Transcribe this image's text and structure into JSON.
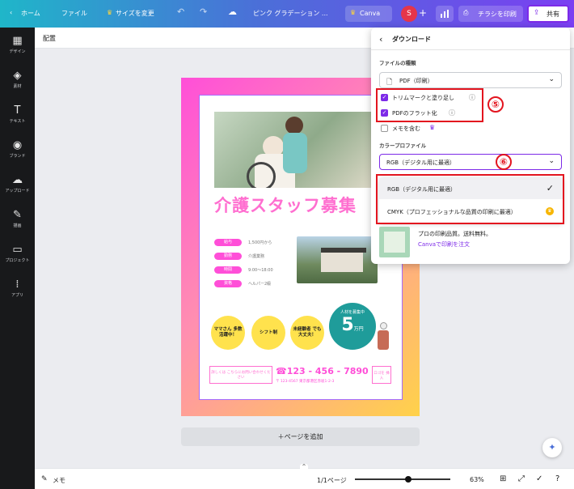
{
  "topbar": {
    "home": "ホーム",
    "file": "ファイル",
    "resize": "サイズを変更",
    "doc_title": "ピンク グラデーション ...",
    "canva_label": "Canva",
    "avatar": "S",
    "print": "チラシを印刷",
    "share": "共有"
  },
  "sidebar": [
    {
      "icon": "▦",
      "label": "デザイン"
    },
    {
      "icon": "◈",
      "label": "素材"
    },
    {
      "icon": "T",
      "label": "テキスト"
    },
    {
      "icon": "◉",
      "label": "ブランド"
    },
    {
      "icon": "☁",
      "label": "アップロード"
    },
    {
      "icon": "✎",
      "label": "描画"
    },
    {
      "icon": "▭",
      "label": "プロジェクト"
    },
    {
      "icon": "⁞",
      "label": "アプリ"
    }
  ],
  "secbar": {
    "label": "配置"
  },
  "poster": {
    "heading": "介護スタッフ募集",
    "rows": [
      {
        "tag": "給与",
        "value": "1,500円から"
      },
      {
        "tag": "勤務",
        "value": "介護業務"
      },
      {
        "tag": "時間",
        "value": "9:00〜18:00"
      },
      {
        "tag": "資格",
        "value": "ヘルパー2級"
      }
    ],
    "circles": [
      "ママさん 多数 活躍中！",
      "シフト制",
      "未経験者 でも 大丈夫！"
    ],
    "teal_top": "人材を募集中",
    "teal_big": "5",
    "teal_unit": "万円",
    "footer_box": "詳しくは こちらにお問い合わせください",
    "phone": "☎123 - 456 - 7890",
    "address": "〒 123-4567 東京都港区赤坂1-2-3",
    "logo": "ロゴを 挿入"
  },
  "add_page": "＋ページを追加",
  "bottombar": {
    "memo": "メモ",
    "pages": "1/1ページ",
    "zoom": "63%"
  },
  "dialog": {
    "title": "ダウンロード",
    "file_type_label": "ファイルの種類",
    "file_type_value": "PDF（印刷）",
    "crop_marks": "トリムマークと塗り足し",
    "flatten_pdf": "PDFのフラット化",
    "include_notes": "メモを含む",
    "color_profile_label": "カラープロファイル",
    "color_profile_value": "RGB（デジタル用に最適）",
    "option_rgb": "RGB（デジタル用に最適）",
    "option_cmyk": "CMYK（プロフェッショナルな品質の印刷に最適）",
    "promo_title": "プロの印刷品質。送料無料。",
    "promo_link": "Canvaで印刷を注文"
  },
  "annotations": {
    "five": "⑤",
    "six": "⑥"
  },
  "colors": {
    "accent": "#7d2ae8",
    "red": "#e3151f",
    "pink": "#ff4fd8",
    "teal": "#1f9c9a",
    "yellow": "#ffe24d"
  }
}
